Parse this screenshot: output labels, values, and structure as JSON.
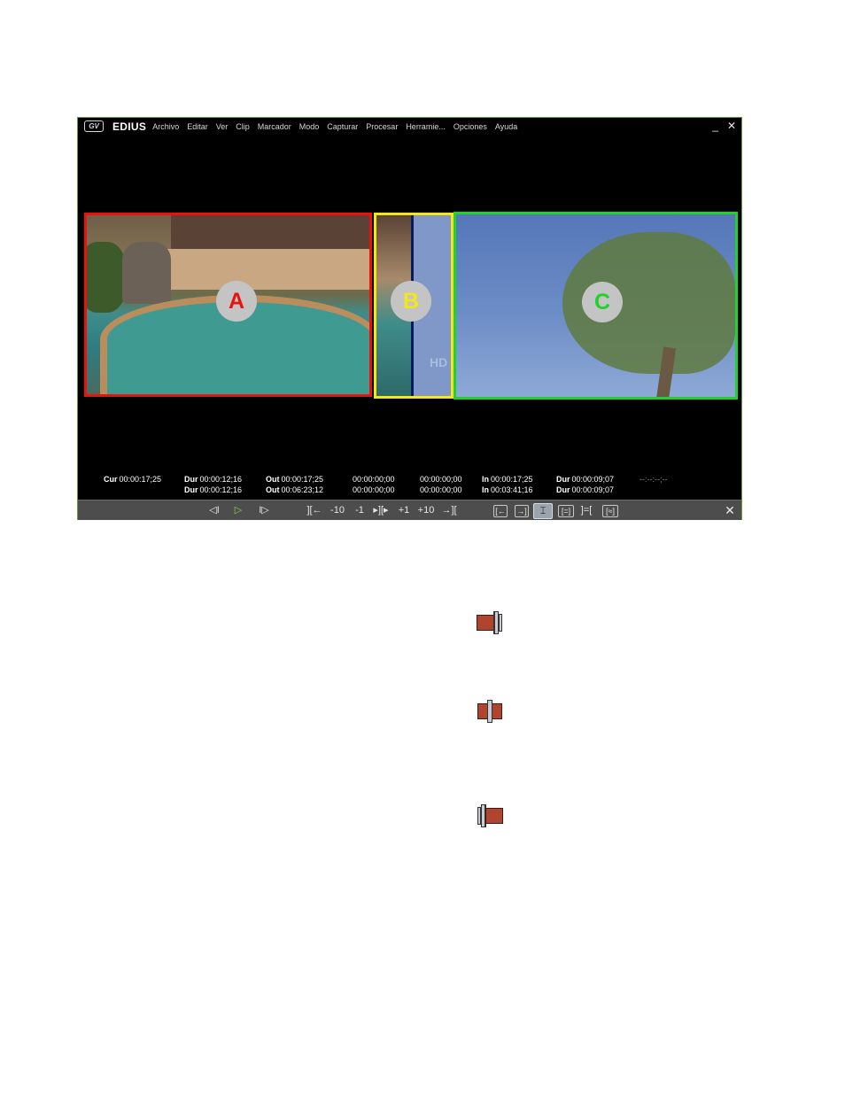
{
  "window": {
    "logo": "GV",
    "brand": "EDIUS",
    "menus": [
      "Archivo",
      "Editar",
      "Ver",
      "Clip",
      "Marcador",
      "Modo",
      "Capturar",
      "Procesar",
      "Herramie...",
      "Opciones",
      "Ayuda"
    ],
    "minimize": "_",
    "close": "✕"
  },
  "panels": {
    "a_label": "A",
    "b_label": "B",
    "c_label": "C",
    "hd_watermark": "HD"
  },
  "timecode": {
    "cur_label": "Cur",
    "cur": "00:00:17;25",
    "dur1_label": "Dur",
    "dur1": "00:00:12;16",
    "dur2_label": "Dur",
    "dur2": "00:00:12;16",
    "out1_label": "Out",
    "out1": "00:00:17;25",
    "out2_label": "Out",
    "out2": "00:06:23;12",
    "blank1": "00:00:00;00",
    "blank2": "00:00:00;00",
    "blank3": "00:00:00;00",
    "blank4": "00:00:00;00",
    "in1_label": "In",
    "in1": "00:00:17;25",
    "in2_label": "In",
    "in2": "00:03:41;16",
    "dur3_label": "Dur",
    "dur3": "00:00:09;07",
    "dur4_label": "Dur",
    "dur4": "00:00:09;07",
    "empty": "--:--:--;--"
  },
  "toolbar": {
    "prev_frame": "◁I",
    "play": "▷",
    "next_frame": "I▷",
    "to_in": "][←",
    "minus10": "-10",
    "minus1": "-1",
    "play_trim": "▸][▸",
    "plus1": "+1",
    "plus10": "+10",
    "to_out": "→][",
    "mode1": "[←",
    "mode2": "→]",
    "mode3": "⌶",
    "mode4": "[=]",
    "mode5": "]=[",
    "mode6": "[≈]",
    "close": "✕"
  }
}
